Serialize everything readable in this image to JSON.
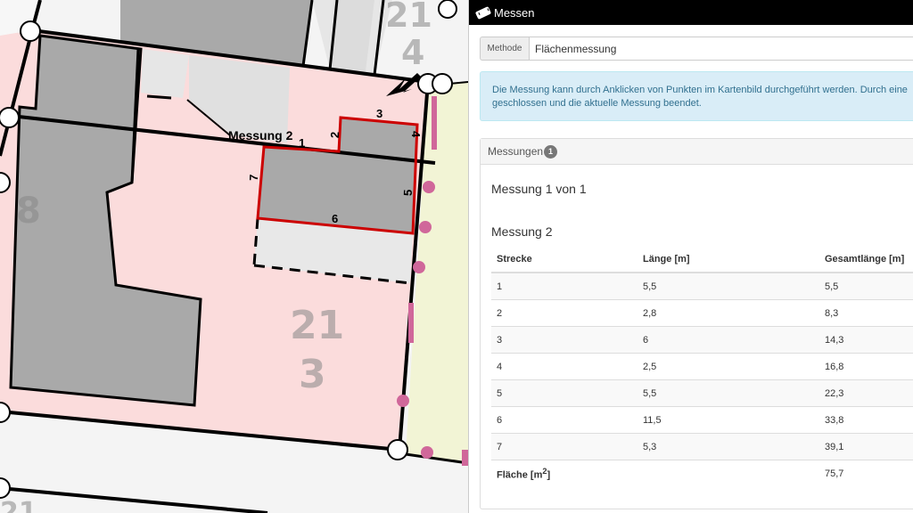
{
  "map": {
    "label_measurement": "Messung 2",
    "segment_labels": [
      "1",
      "2",
      "3",
      "4",
      "5",
      "6",
      "7"
    ],
    "parcel_number_main_top": "21",
    "parcel_number_main_bottom": "3",
    "parcel_number_top_right_top": "21",
    "parcel_number_top_right_bottom": "4",
    "parcel_number_left": "8",
    "parcel_number_bottom_left": "21"
  },
  "panel": {
    "title": "Messen",
    "method_label": "Methode",
    "method_value": "Flächenmessung",
    "info_line1": "Die Messung kann durch Anklicken von Punkten im Kartenbild durchgeführt werden. Durch eine",
    "info_line2": "geschlossen und die aktuelle Messung beendet.",
    "measurements_header": "Messungen",
    "measurements_count": "1",
    "count_title": "Messung 1 von 1",
    "measurement_title": "Messung 2",
    "table_headers": [
      "Strecke",
      "Länge [m]",
      "Gesamtlänge [m]"
    ],
    "rows": [
      {
        "segment": "1",
        "length": "5,5",
        "total": "5,5"
      },
      {
        "segment": "2",
        "length": "2,8",
        "total": "8,3"
      },
      {
        "segment": "3",
        "length": "6",
        "total": "14,3"
      },
      {
        "segment": "4",
        "length": "2,5",
        "total": "16,8"
      },
      {
        "segment": "5",
        "length": "5,5",
        "total": "22,3"
      },
      {
        "segment": "6",
        "length": "11,5",
        "total": "33,8"
      },
      {
        "segment": "7",
        "length": "5,3",
        "total": "39,1"
      }
    ],
    "area_label": "Fläche [m",
    "area_sup": "2",
    "area_label_end": "]",
    "area_value": "75,7"
  },
  "colors": {
    "parcel_fill": "#fbdcdc",
    "building": "#a9a9a9",
    "measurement_line": "#cc0000",
    "boundary_marker": "#d0679a",
    "neighbor_fill": "#f2f4d5",
    "info_bg": "#d9edf7"
  }
}
